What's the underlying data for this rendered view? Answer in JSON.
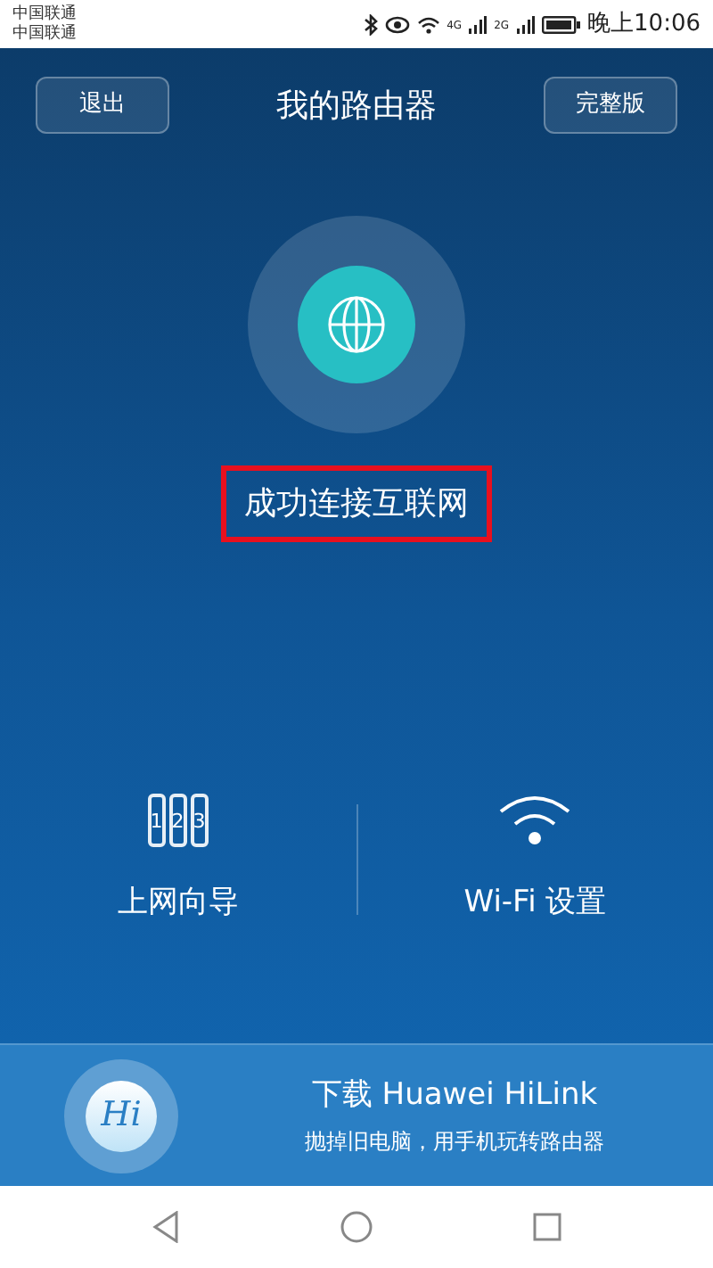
{
  "status_bar": {
    "carriers": [
      "中国联通",
      "中国联通"
    ],
    "network_1": "4G",
    "network_2": "2G",
    "time": "晚上10:06"
  },
  "header": {
    "back_button": "退出",
    "title": "我的路由器",
    "full_button": "完整版"
  },
  "connection": {
    "status": "成功连接互联网",
    "highlighted": true
  },
  "actions": [
    {
      "kind": "wizard",
      "label": "上网向导",
      "digits": [
        "1",
        "2",
        "3"
      ]
    },
    {
      "kind": "wifi",
      "label": "Wi-Fi 设置"
    }
  ],
  "banner": {
    "logo": "Hi",
    "title": "下载 Huawei HiLink",
    "subtitle": "抛掉旧电脑，用手机玩转路由器"
  }
}
